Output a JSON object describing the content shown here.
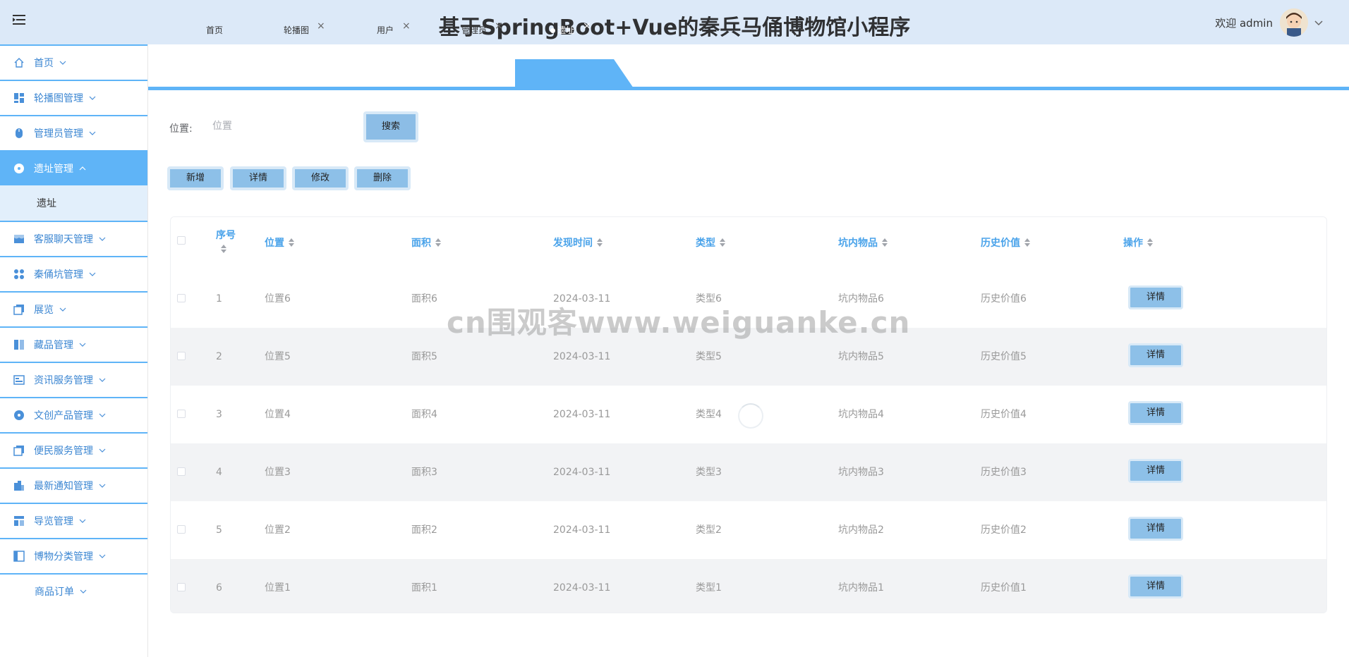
{
  "header": {
    "title": "基于SpringBoot+Vue的秦兵马俑博物馆小程序",
    "welcome": "欢迎 admin"
  },
  "sidebar": {
    "items": [
      {
        "label": "首页",
        "icon": "home-icon",
        "expanded": false
      },
      {
        "label": "轮播图管理",
        "icon": "dashboard-icon",
        "expanded": false
      },
      {
        "label": "管理员管理",
        "icon": "mouse-icon",
        "expanded": false
      },
      {
        "label": "遗址管理",
        "icon": "disc-icon",
        "expanded": true,
        "active": true
      },
      {
        "label": "遗址",
        "sub": true
      },
      {
        "label": "客服聊天管理",
        "icon": "shop-icon",
        "expanded": false
      },
      {
        "label": "秦俑坑管理",
        "icon": "grid-icon",
        "expanded": false
      },
      {
        "label": "展览",
        "icon": "copy-icon",
        "expanded": false
      },
      {
        "label": "藏品管理",
        "icon": "columns-icon",
        "expanded": false
      },
      {
        "label": "资讯服务管理",
        "icon": "panel-icon",
        "expanded": false
      },
      {
        "label": "文创产品管理",
        "icon": "disc-icon",
        "expanded": false
      },
      {
        "label": "便民服务管理",
        "icon": "copy-icon",
        "expanded": false
      },
      {
        "label": "最新通知管理",
        "icon": "building-icon",
        "expanded": false
      },
      {
        "label": "导览管理",
        "icon": "layout-icon",
        "expanded": false
      },
      {
        "label": "博物分类管理",
        "icon": "sidebar-icon",
        "expanded": false
      },
      {
        "label": "商品订单",
        "icon": "",
        "expanded": false
      }
    ]
  },
  "tabs": [
    {
      "label": "首页",
      "closable": false
    },
    {
      "label": "轮播图",
      "closable": true
    },
    {
      "label": "用户",
      "closable": true
    },
    {
      "label": "管理员",
      "closable": true
    },
    {
      "label": "遗址",
      "closable": true,
      "active": true
    }
  ],
  "tab_close_glyph": "×",
  "search": {
    "label": "位置:",
    "placeholder": "位置",
    "button": "搜索"
  },
  "actions": {
    "add": "新增",
    "detail": "详情",
    "edit": "修改",
    "delete": "删除"
  },
  "table": {
    "columns": [
      "序号",
      "位置",
      "面积",
      "发现时间",
      "类型",
      "坑内物品",
      "历史价值",
      "操作"
    ],
    "rows": [
      {
        "index": "1",
        "location": "位置6",
        "area": "面积6",
        "date": "2024-03-11",
        "type": "类型6",
        "items": "坑内物品6",
        "value": "历史价值6",
        "action": "详情"
      },
      {
        "index": "2",
        "location": "位置5",
        "area": "面积5",
        "date": "2024-03-11",
        "type": "类型5",
        "items": "坑内物品5",
        "value": "历史价值5",
        "action": "详情"
      },
      {
        "index": "3",
        "location": "位置4",
        "area": "面积4",
        "date": "2024-03-11",
        "type": "类型4",
        "items": "坑内物品4",
        "value": "历史价值4",
        "action": "详情"
      },
      {
        "index": "4",
        "location": "位置3",
        "area": "面积3",
        "date": "2024-03-11",
        "type": "类型3",
        "items": "坑内物品3",
        "value": "历史价值3",
        "action": "详情"
      },
      {
        "index": "5",
        "location": "位置2",
        "area": "面积2",
        "date": "2024-03-11",
        "type": "类型2",
        "items": "坑内物品2",
        "value": "历史价值2",
        "action": "详情"
      },
      {
        "index": "6",
        "location": "位置1",
        "area": "面积1",
        "date": "2024-03-11",
        "type": "类型1",
        "items": "坑内物品1",
        "value": "历史价值1",
        "action": "详情"
      }
    ]
  },
  "watermark": "cn围观客www.weiguanke.cn",
  "colors": {
    "accent": "#5fb4f7",
    "header_bg": "#dce9f8",
    "button": "#8dc0e8",
    "column_header": "#4aa3ea"
  }
}
